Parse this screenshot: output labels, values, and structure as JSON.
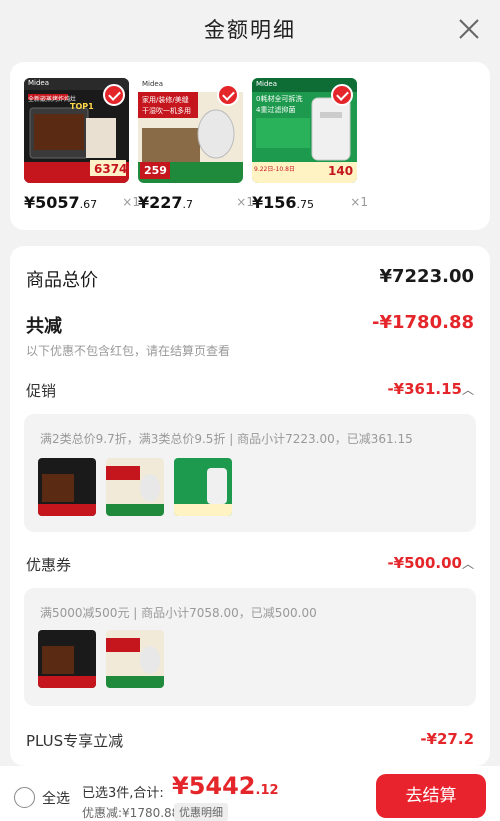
{
  "header": {
    "title": "金额明细"
  },
  "products": [
    {
      "price_main": "¥5057",
      "price_dec": ".67",
      "qty": "×1",
      "thumb_brand": "Midea",
      "thumb_text": "全新嵌蒸烤炸炖灶",
      "thumb_badge": "TOP1",
      "thumb_price": "6374"
    },
    {
      "price_main": "¥227",
      "price_dec": ".7",
      "qty": "×1",
      "thumb_brand": "Midea",
      "thumb_text": "家用/装修/美缝",
      "thumb_sub": "干湿吹一机多用",
      "thumb_price": "259"
    },
    {
      "price_main": "¥156",
      "price_dec": ".75",
      "qty": "×1",
      "thumb_brand": "Midea",
      "thumb_text": "0耗材全可拆洗",
      "thumb_sub": "4重过滤抑菌",
      "thumb_date": "9.22日-10.8日",
      "thumb_price": "140"
    }
  ],
  "detail": {
    "total_label": "商品总价",
    "total_value": "¥7223.00",
    "discount_label": "共减",
    "discount_value": "-¥1780.88",
    "discount_note": "以下优惠不包含红包，请在结算页查看",
    "promo_label": "促销",
    "promo_value": "-¥361.15",
    "promo_desc": "满2类总价9.7折，满3类总价9.5折 | 商品小计7223.00，已减361.15",
    "coupon_label": "优惠券",
    "coupon_value": "-¥500.00",
    "coupon_desc": "满5000减500元 | 商品小计7058.00，已减500.00",
    "plus_label": "PLUS专享立减",
    "plus_value": "-¥27.2"
  },
  "footer": {
    "select_all": "全选",
    "selected_text": "已选3件,合计:",
    "total_main": "¥5442",
    "total_dec": ".12",
    "saved_text": "优惠减:¥1780.88",
    "detail_tag": "优惠明细",
    "checkout": "去结算"
  },
  "colors": {
    "accent": "#e4262a",
    "cta": "#e8232d"
  },
  "icons": {
    "close": "close-icon",
    "check": "check-icon",
    "chevron": "chevron-up-icon",
    "radio": "radio-icon"
  }
}
